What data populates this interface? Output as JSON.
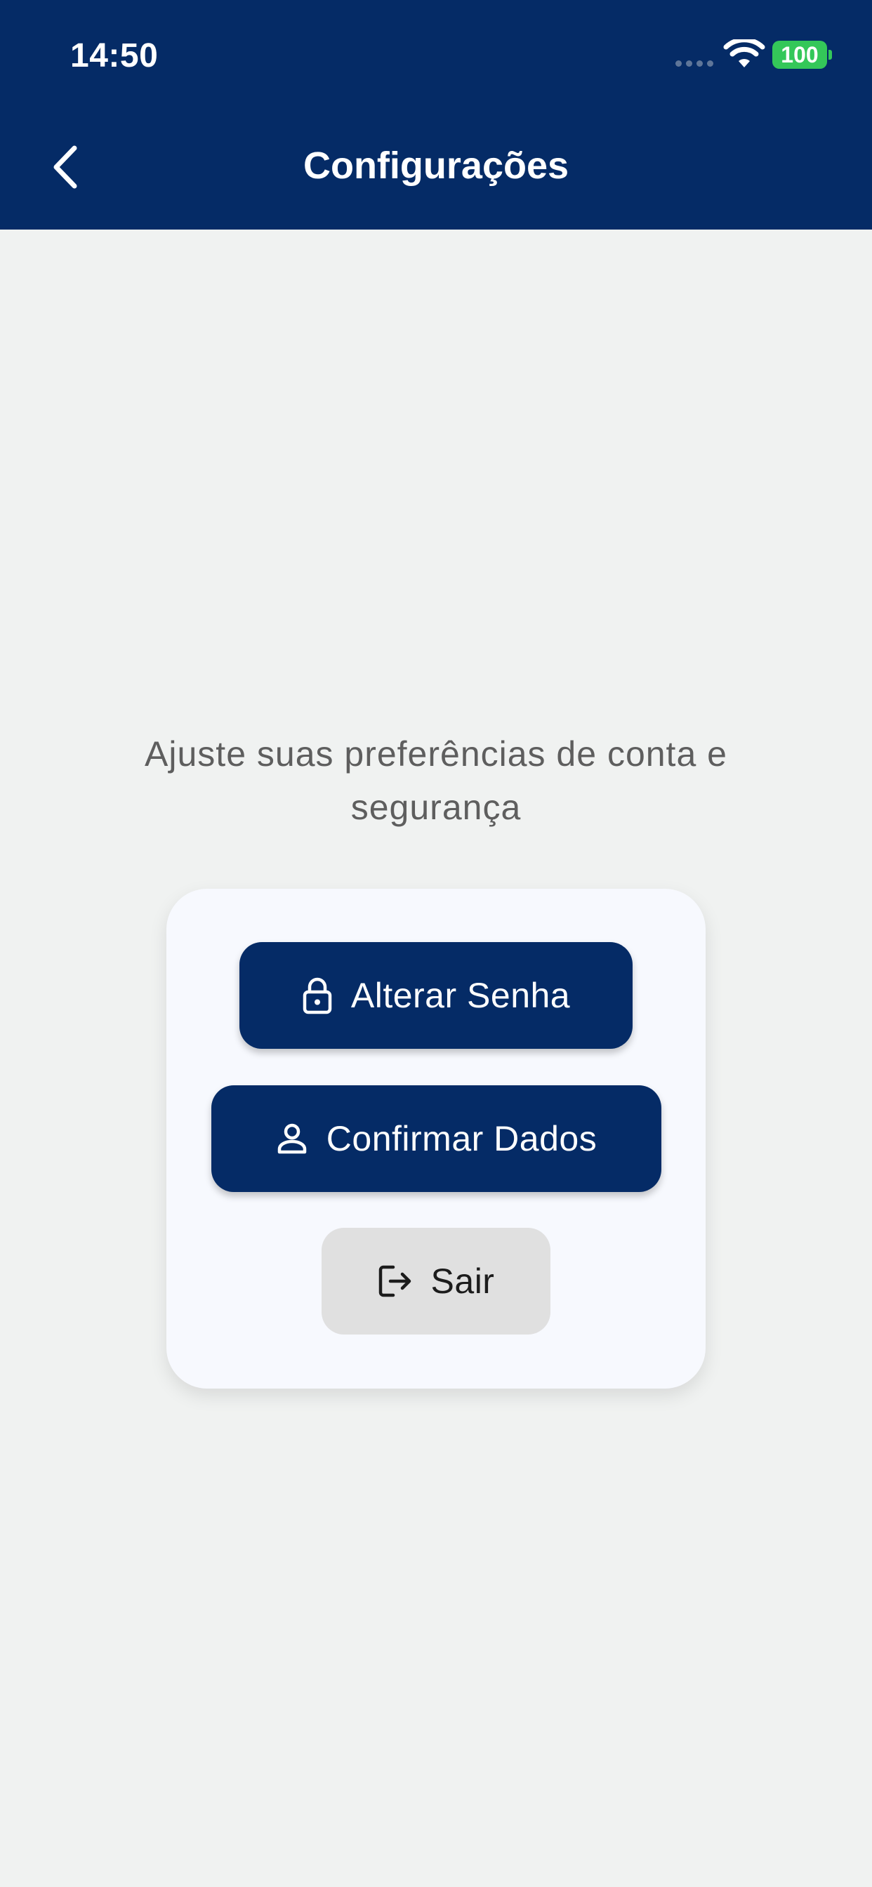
{
  "status_bar": {
    "time": "14:50",
    "battery_level": "100"
  },
  "app_bar": {
    "title": "Configurações",
    "back_icon": "chevron-left-icon"
  },
  "main": {
    "subtitle_line1": "Ajuste suas preferências de conta e",
    "subtitle_line2": "segurança",
    "buttons": [
      {
        "label": "Alterar Senha",
        "icon": "lock-icon"
      },
      {
        "label": "Confirmar Dados",
        "icon": "user-icon"
      },
      {
        "label": "Sair",
        "icon": "logout-icon"
      }
    ]
  },
  "colors": {
    "primary": "#052b66",
    "background": "#f0f2f1",
    "card": "#f7f9fe",
    "secondary_button": "#e0e0e0",
    "battery": "#34c759"
  }
}
